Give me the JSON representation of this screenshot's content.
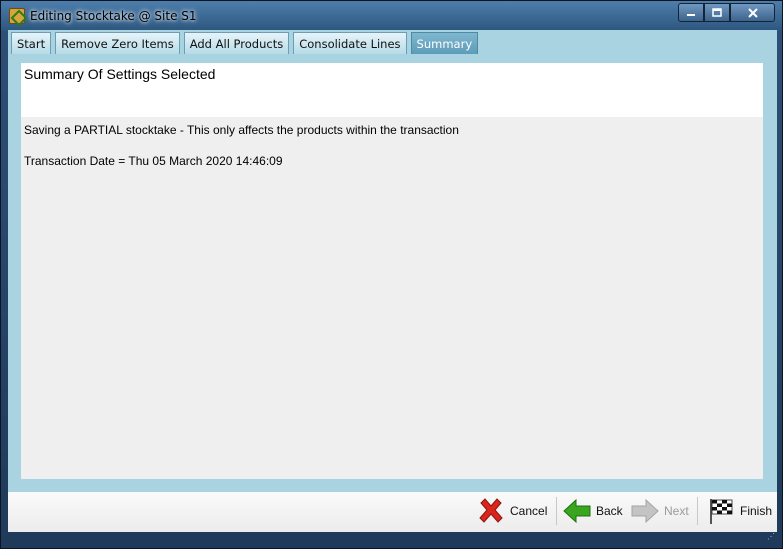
{
  "window": {
    "title": "Editing Stocktake @ Site S1",
    "controls": {
      "minimize_icon": "minimize-icon",
      "maximize_icon": "maximize-icon",
      "close_icon": "close-icon"
    }
  },
  "tabs": [
    {
      "label": "Start"
    },
    {
      "label": "Remove Zero Items"
    },
    {
      "label": "Add All Products"
    },
    {
      "label": "Consolidate Lines"
    },
    {
      "label": "Summary",
      "active": true
    }
  ],
  "summary": {
    "heading": "Summary Of Settings Selected",
    "line1": "Saving a PARTIAL stocktake - This only affects the products within the transaction",
    "line2": "Transaction Date = Thu 05 March 2020 14:46:09"
  },
  "footer": {
    "cancel_label": "Cancel",
    "back_label": "Back",
    "next_label": "Next",
    "finish_label": "Finish"
  },
  "colors": {
    "accent": "#a9d3e1",
    "active_tab": "#6aa8c2",
    "cancel_red": "#d9261c",
    "back_green": "#3aa51f"
  }
}
